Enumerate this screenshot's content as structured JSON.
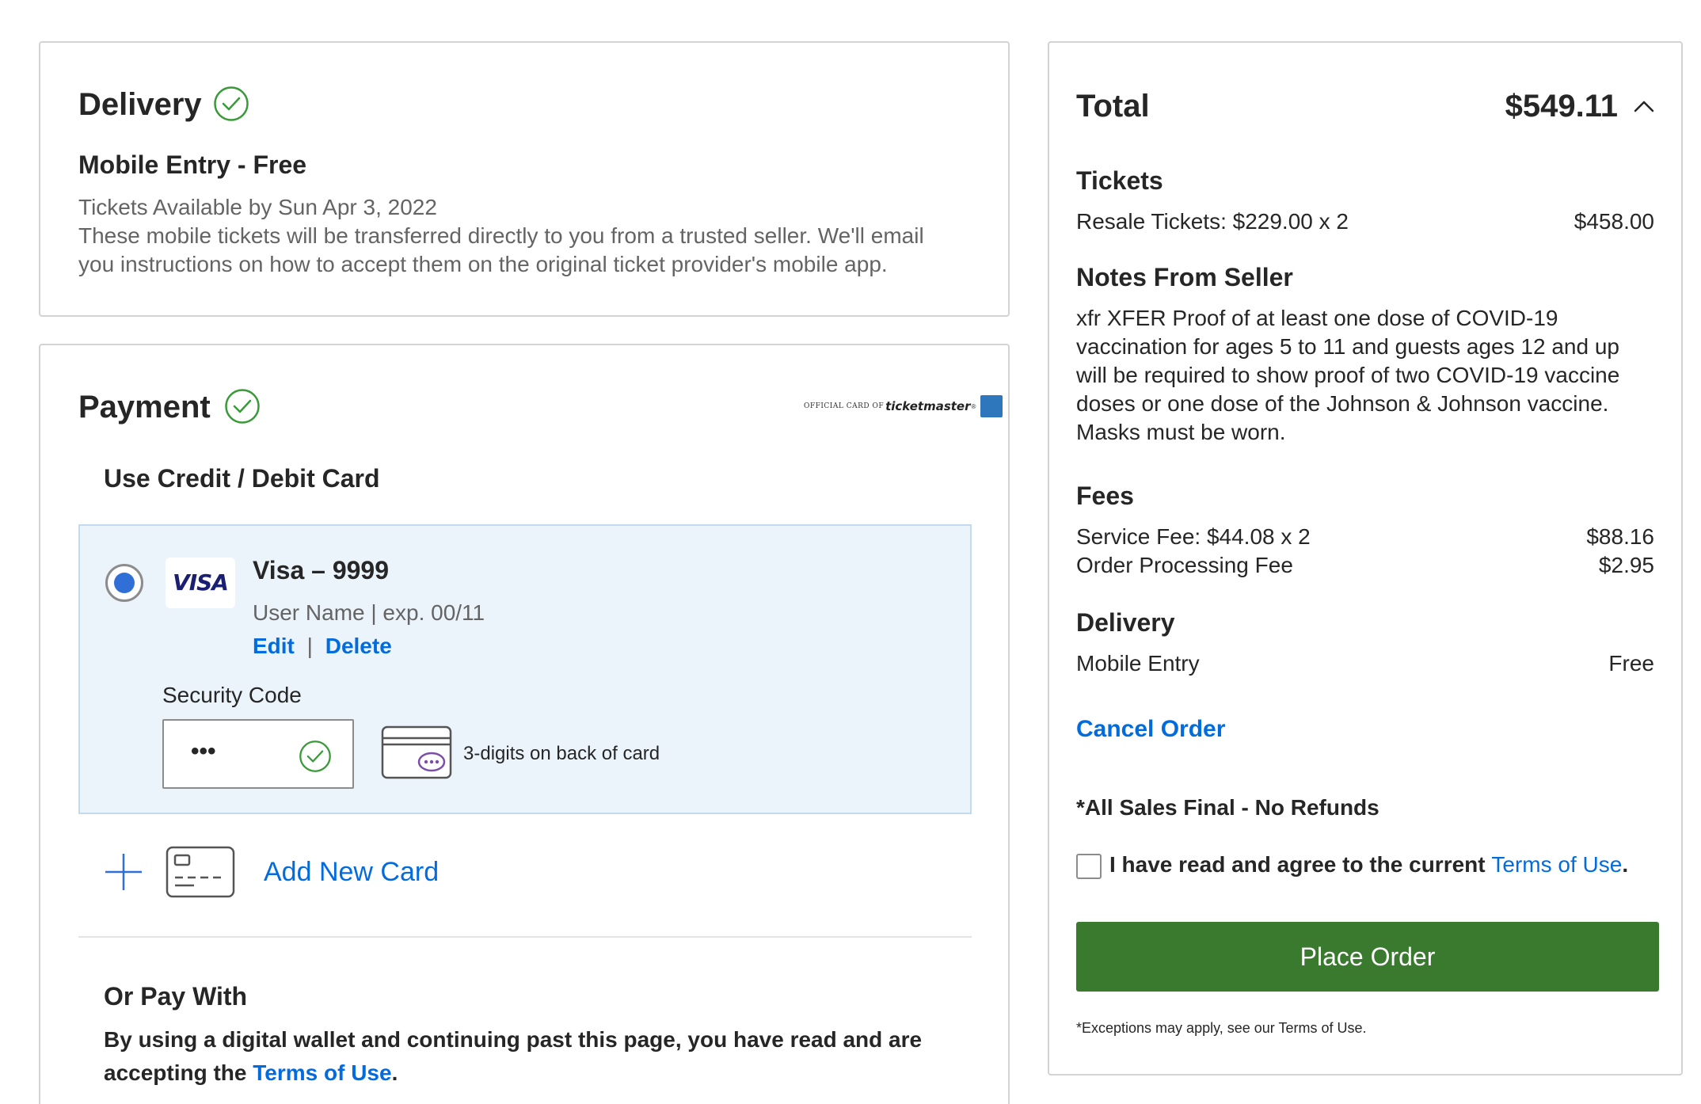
{
  "delivery": {
    "title": "Delivery",
    "method": "Mobile Entry - Free",
    "availability": "Tickets Available by Sun Apr 3, 2022",
    "description_line1": "These mobile tickets will be transferred directly to you from a trusted seller. We'll email",
    "description_line2": "you instructions on how to accept them on the original ticket provider's mobile app."
  },
  "payment": {
    "title": "Payment",
    "official_card_text": "OFFICIAL CARD OF",
    "official_card_brand": "ticketmaster",
    "use_card_label": "Use Credit / Debit Card",
    "card": {
      "brand_logo": "VISA",
      "name": "Visa – 9999",
      "details": "User Name | exp. 00/11",
      "edit_label": "Edit",
      "separator": "|",
      "delete_label": "Delete",
      "security_label": "Security Code",
      "security_value": "•••",
      "cvv_hint": "3-digits on back of card"
    },
    "add_card_label": "Add New Card",
    "or_pay_with_label": "Or Pay With",
    "wallet_text_line1": "By using a digital wallet and continuing past this page, you have read and are",
    "wallet_text_prefix": "accepting the ",
    "wallet_terms_link": "Terms of Use",
    "wallet_text_suffix": "."
  },
  "summary": {
    "total_label": "Total",
    "total_value": "$549.11",
    "tickets_heading": "Tickets",
    "tickets_line": "Resale Tickets: $229.00 x 2",
    "tickets_amount": "$458.00",
    "notes_heading": "Notes From Seller",
    "notes_lines": [
      "xfr XFER Proof of at least one dose of COVID-19",
      "vaccination for ages 5 to 11 and guests ages 12 and up",
      "will be required to show proof of two COVID-19 vaccine",
      "doses or one dose of the Johnson & Johnson vaccine.",
      "Masks must be worn."
    ],
    "fees_heading": "Fees",
    "service_fee_label": "Service Fee: $44.08 x 2",
    "service_fee_amount": "$88.16",
    "processing_fee_label": "Order Processing Fee",
    "processing_fee_amount": "$2.95",
    "delivery_heading": "Delivery",
    "delivery_label": "Mobile Entry",
    "delivery_amount": "Free",
    "cancel_label": "Cancel Order",
    "sales_final": "*All Sales Final - No Refunds",
    "agree_prefix": "I have read and agree to the current ",
    "agree_link": "Terms of Use",
    "agree_suffix": ".",
    "place_order_label": "Place Order",
    "exceptions_note": "*Exceptions may apply, see our Terms of Use."
  },
  "colors": {
    "link": "#026cdf",
    "success_green": "#3a9a3a",
    "place_order_bg": "#3a7a2f",
    "card_selected_bg": "#ebf3fb",
    "amex_blue": "#2e77bc"
  },
  "icons": [
    "check-circle-icon",
    "visa-logo-icon",
    "cvv-card-icon",
    "plus-icon",
    "credit-card-icon",
    "chevron-up-icon",
    "amex-logo-icon"
  ]
}
